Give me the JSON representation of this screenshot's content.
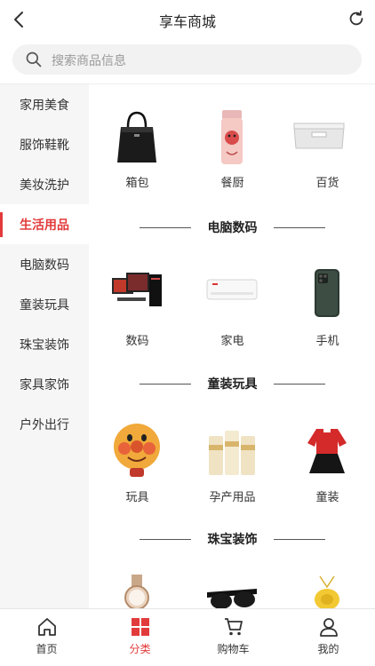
{
  "header": {
    "title": "享车商城"
  },
  "search": {
    "placeholder": "搜索商品信息"
  },
  "sidebar": {
    "items": [
      {
        "label": "家用美食"
      },
      {
        "label": "服饰鞋靴"
      },
      {
        "label": "美妆洗护"
      },
      {
        "label": "生活用品"
      },
      {
        "label": "电脑数码"
      },
      {
        "label": "童装玩具"
      },
      {
        "label": "珠宝装饰"
      },
      {
        "label": "家具家饰"
      },
      {
        "label": "户外出行"
      }
    ],
    "active": "生活用品"
  },
  "content": {
    "row1": [
      {
        "name": "箱包",
        "icon": "handbag-image"
      },
      {
        "name": "餐厨",
        "icon": "thermos-cup-image"
      },
      {
        "name": "百货",
        "icon": "storage-box-image"
      }
    ],
    "sections": [
      {
        "title": "电脑数码",
        "items": [
          {
            "name": "数码",
            "icon": "computer-set-image"
          },
          {
            "name": "家电",
            "icon": "air-conditioner-image"
          },
          {
            "name": "手机",
            "icon": "smartphone-image"
          }
        ]
      },
      {
        "title": "童装玩具",
        "items": [
          {
            "name": "玩具",
            "icon": "toy-face-image"
          },
          {
            "name": "孕产用品",
            "icon": "milk-powder-image"
          },
          {
            "name": "童装",
            "icon": "kids-dress-image"
          }
        ]
      },
      {
        "title": "珠宝装饰",
        "items": [
          {
            "name": "",
            "icon": "watch-image"
          },
          {
            "name": "",
            "icon": "sunglasses-image"
          },
          {
            "name": "",
            "icon": "gold-pendant-image"
          }
        ]
      }
    ]
  },
  "tabbar": {
    "items": [
      {
        "label": "首页",
        "icon": "home-icon"
      },
      {
        "label": "分类",
        "icon": "category-icon"
      },
      {
        "label": "购物车",
        "icon": "cart-icon"
      },
      {
        "label": "我的",
        "icon": "user-icon"
      }
    ],
    "active": "分类"
  },
  "colors": {
    "accent": "#e23b3b",
    "sidebar_bg": "#f6f6f6",
    "search_bg": "#f2f2f2"
  }
}
